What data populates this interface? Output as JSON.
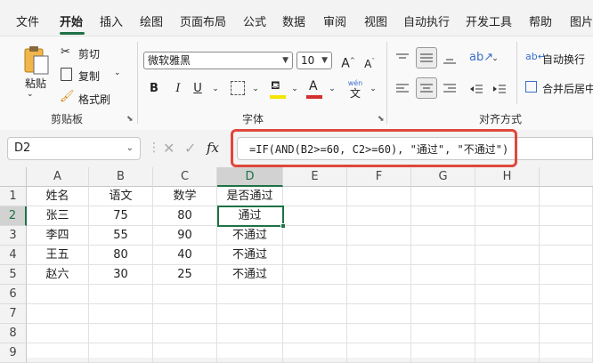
{
  "tabs": [
    "文件",
    "开始",
    "插入",
    "绘图",
    "页面布局",
    "公式",
    "数据",
    "审阅",
    "视图",
    "自动执行",
    "开发工具",
    "帮助",
    "图片"
  ],
  "ribbon": {
    "clipboard": {
      "paste": "粘贴",
      "cut": "剪切",
      "copy": "复制",
      "format_painter": "格式刷",
      "label": "剪贴板"
    },
    "font": {
      "name": "微软雅黑",
      "size": "10",
      "bold": "B",
      "italic": "I",
      "underline": "U",
      "label": "字体",
      "wen": "wén",
      "wen_char": "文"
    },
    "alignment": {
      "wrap": "自动换行",
      "merge": "合并后居中",
      "label": "对齐方式"
    }
  },
  "formula_bar": {
    "name_box": "D2",
    "fx": "fx",
    "formula": "=IF(AND(B2>=60, C2>=60), \"通过\", \"不通过\")"
  },
  "sheet": {
    "columns": [
      "A",
      "B",
      "C",
      "D",
      "E",
      "F",
      "G",
      "H"
    ],
    "rows": [
      "1",
      "2",
      "3",
      "4",
      "5",
      "6",
      "7",
      "8",
      "9"
    ],
    "cells": [
      [
        "姓名",
        "语文",
        "数学",
        "是否通过"
      ],
      [
        "张三",
        "75",
        "80",
        "通过"
      ],
      [
        "李四",
        "55",
        "90",
        "不通过"
      ],
      [
        "王五",
        "80",
        "40",
        "不通过"
      ],
      [
        "赵六",
        "30",
        "25",
        "不通过"
      ]
    ]
  },
  "colors": {
    "accent": "#1e7145",
    "highlight_outline": "#e0473d",
    "font_color_bar": "#d32f2f",
    "fill_color_bar": "#f5e400"
  }
}
